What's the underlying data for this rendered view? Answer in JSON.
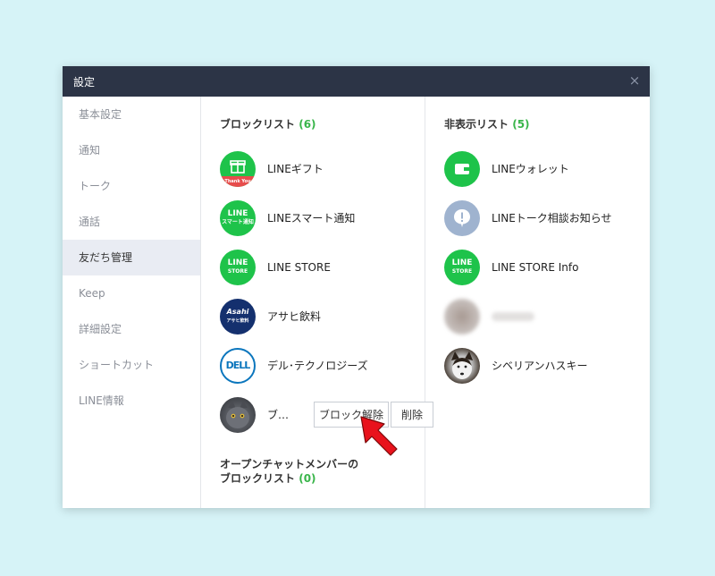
{
  "window": {
    "title": "設定",
    "close_icon": "×"
  },
  "sidebar": {
    "items": [
      {
        "label": "基本設定",
        "active": false
      },
      {
        "label": "通知",
        "active": false
      },
      {
        "label": "トーク",
        "active": false
      },
      {
        "label": "通話",
        "active": false
      },
      {
        "label": "友だち管理",
        "active": true
      },
      {
        "label": "Keep",
        "active": false
      },
      {
        "label": "詳細設定",
        "active": false
      },
      {
        "label": "ショートカット",
        "active": false
      },
      {
        "label": "LINE情報",
        "active": false
      }
    ]
  },
  "block_list": {
    "title": "ブロックリスト",
    "count": "(6)",
    "items": [
      {
        "name": "LINEギフト",
        "avatar_text": "Thank You"
      },
      {
        "name": "LINEスマート通知",
        "avatar_text": "LINE",
        "avatar_sub": "スマート通知"
      },
      {
        "name": "LINE STORE",
        "avatar_text": "LINE",
        "avatar_sub": "STORE"
      },
      {
        "name": "アサヒ飲料",
        "avatar_text": "Asahi",
        "avatar_sub": "アサヒ飲料"
      },
      {
        "name": "デル･テクノロジーズ",
        "avatar_text": "DELL"
      },
      {
        "name": "ブ…"
      }
    ],
    "unblock_label": "ブロック解除",
    "delete_label": "削除"
  },
  "openchat_block": {
    "title_line1": "オープンチャットメンバーの",
    "title_line2": "ブロックリスト",
    "count": "(0)"
  },
  "hidden_list": {
    "title": "非表示リスト",
    "count": "(5)",
    "items": [
      {
        "name": "LINEウォレット"
      },
      {
        "name": "LINEトーク相談お知らせ"
      },
      {
        "name": "LINE STORE Info",
        "avatar_text": "LINE",
        "avatar_sub": "STORE"
      },
      {
        "name": ""
      },
      {
        "name": "シベリアンハスキー"
      }
    ]
  },
  "colors": {
    "accent": "#39b54a",
    "titlebar": "#2c3446",
    "line_green": "#1ec34a",
    "arrow": "#e8121c"
  },
  "icons": {
    "close": "close-icon",
    "pointer": "red-arrow-pointer"
  }
}
